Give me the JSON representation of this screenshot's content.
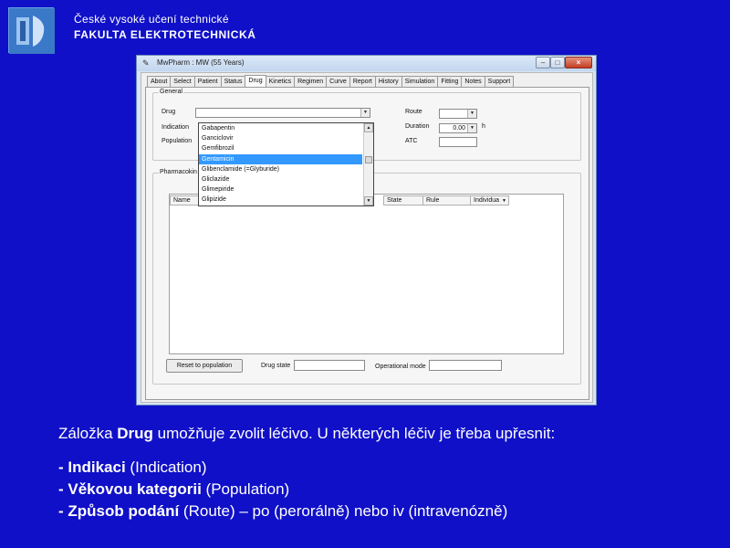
{
  "header": {
    "line1": "České vysoké učení technické",
    "line2": "FAKULTA ELEKTROTECHNICKÁ"
  },
  "window": {
    "title": "MwPharm : MW (55 Years)",
    "tabs": [
      "About",
      "Select",
      "Patient",
      "Status",
      "Drug",
      "Kinetics",
      "Regimen",
      "Curve",
      "Report",
      "History",
      "Simulation",
      "Fitting",
      "Notes",
      "Support"
    ],
    "active_tab": "Drug",
    "general": {
      "group_label": "General",
      "drug_label": "Drug",
      "indication_label": "Indication",
      "population_label": "Population",
      "route_label": "Route",
      "duration_label": "Duration",
      "duration_value": "0.00",
      "duration_unit": "h",
      "atc_label": "ATC"
    },
    "drug_list": {
      "items": [
        "Gabapentin",
        "Ganciclovir",
        "Gemfibrozil",
        "Gentamicin",
        "Glibenclamide (=Glyburide)",
        "Gliclazide",
        "Glimepiride",
        "Glipizide"
      ],
      "selected": "Gentamicin"
    },
    "pharmacokinetics": {
      "group_label": "Pharmacokin",
      "columns": [
        "Name",
        "State",
        "Rule",
        "Individua"
      ]
    },
    "footer": {
      "reset_button": "Reset to population",
      "drug_state_label": "Drug state",
      "drug_state_value": "",
      "operational_mode_label": "Operational mode",
      "operational_mode_value": ""
    }
  },
  "slide": {
    "intro_pre": "Záložka ",
    "intro_bold": "Drug",
    "intro_post": " umožňuje zvolit léčivo. U některých léčiv je třeba upřesnit:",
    "bullets": [
      {
        "bold": "- Indikaci",
        "rest": " (Indication)"
      },
      {
        "bold": "- Věkovou kategorii",
        "rest": " (Population)"
      },
      {
        "bold": "- Způsob podání",
        "rest": " (Route) – po (perorálně) nebo iv (intravenózně)"
      }
    ]
  },
  "icons": {
    "logo": "cvut-logo-icon",
    "app": "mwpharm-app-icon",
    "dropdown": "chevron-down-icon"
  },
  "colors": {
    "background": "#1010c8",
    "selection": "#3399ff",
    "text": "#ffffff"
  }
}
